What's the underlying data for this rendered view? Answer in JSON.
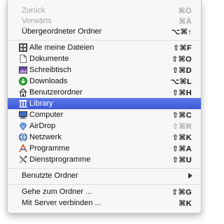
{
  "menu": {
    "back": {
      "label": "Zurück",
      "shortcut": "⌘Ö"
    },
    "forward": {
      "label": "Vorwärts",
      "shortcut": "⌘Ä"
    },
    "parent": {
      "label": "Übergeordneter Ordner",
      "shortcut": "⌥⌘↑"
    },
    "places": [
      {
        "label": "Alle meine Dateien",
        "shortcut": "⇧⌘F",
        "icon": "all-files-icon"
      },
      {
        "label": "Dokumente",
        "shortcut": "⇧⌘O",
        "icon": "documents-icon"
      },
      {
        "label": "Schreibtisch",
        "shortcut": "⇧⌘D",
        "icon": "desktop-icon"
      },
      {
        "label": "Downloads",
        "shortcut": "⌥⌘L",
        "icon": "downloads-icon"
      },
      {
        "label": "Benutzerordner",
        "shortcut": "⇧⌘H",
        "icon": "home-icon"
      },
      {
        "label": "Library",
        "shortcut": "",
        "icon": "library-icon",
        "selected": true
      },
      {
        "label": "Computer",
        "shortcut": "⇧⌘C",
        "icon": "computer-icon"
      },
      {
        "label": "AirDrop",
        "shortcut": "⇧⌘R",
        "icon": "airdrop-icon",
        "shortcut_dim": true
      },
      {
        "label": "Netzwerk",
        "shortcut": "⇧⌘K",
        "icon": "network-icon"
      },
      {
        "label": "Programme",
        "shortcut": "⇧⌘A",
        "icon": "applications-icon"
      },
      {
        "label": "Dienstprogramme",
        "shortcut": "⇧⌘U",
        "icon": "utilities-icon"
      }
    ],
    "recent": {
      "label": "Benutzte Ordner"
    },
    "goto_folder": {
      "label": "Gehe zum Ordner ...",
      "shortcut": "⇧⌘G"
    },
    "connect_server": {
      "label": "Mit Server verbinden ...",
      "shortcut": "⌘K"
    }
  },
  "colors": {
    "selection": "#3d5ad8",
    "disabled": "#a6a6a6"
  }
}
